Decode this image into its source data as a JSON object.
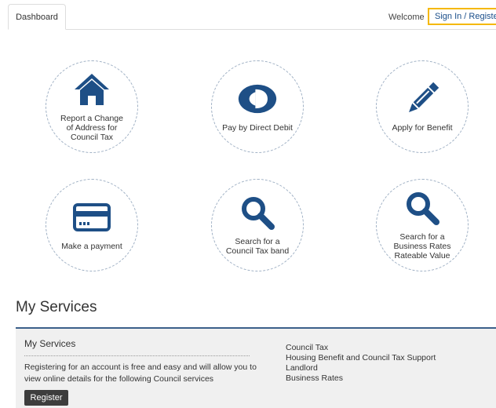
{
  "nav": {
    "dashboard_tab": "Dashboard",
    "welcome": "Welcome",
    "signin": "Sign In / Register"
  },
  "tiles": [
    {
      "label": "Report a Change of Address for Council Tax",
      "icon": "house-icon"
    },
    {
      "label": "Pay by Direct Debit",
      "icon": "direct-debit-icon"
    },
    {
      "label": "Apply for Benefit",
      "icon": "pencil-icon"
    },
    {
      "label": "Make a payment",
      "icon": "card-icon"
    },
    {
      "label": "Search for a Council Tax band",
      "icon": "search-icon"
    },
    {
      "label": "Search for a Business Rates Rateable Value",
      "icon": "search-icon"
    }
  ],
  "section": {
    "title": "My Services",
    "panel_title": "My Services",
    "description": "Registering for an account is free and easy and will allow you to view online details for the following Council services",
    "register_label": "Register",
    "services": [
      "Council Tax",
      "Housing Benefit and Council Tax Support",
      "Landlord",
      "Business Rates"
    ]
  },
  "colors": {
    "icon_blue": "#1e4f86",
    "highlight": "#f5b800",
    "panel_border": "#3b5f8a"
  }
}
